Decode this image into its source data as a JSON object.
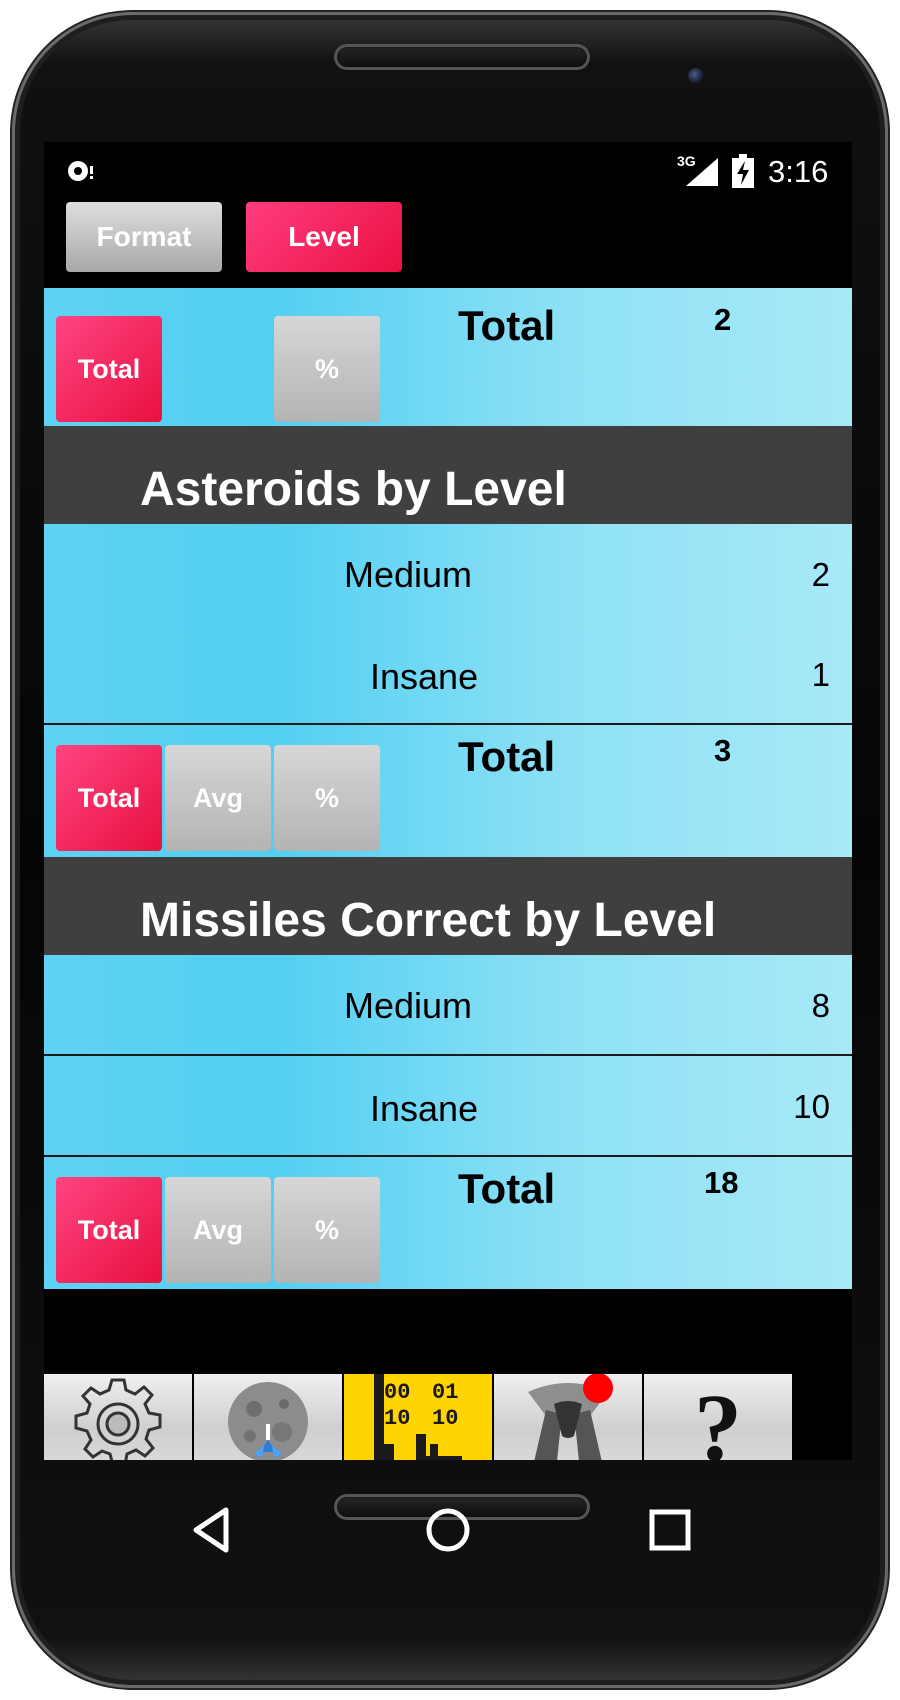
{
  "status_bar": {
    "notification_icon": "wifi-debug-icon",
    "network_type": "3G",
    "time": "3:16"
  },
  "top_tabs": [
    {
      "label": "Format",
      "active": false
    },
    {
      "label": "Level",
      "active": true
    }
  ],
  "summary": {
    "buttons": {
      "total": "Total",
      "percent": "%"
    },
    "total_label": "Total",
    "total_value": "2"
  },
  "sections": [
    {
      "title": "Asteroids by Level",
      "rows": [
        {
          "label": "Medium",
          "value": "2"
        },
        {
          "label": "Insane",
          "value": "1"
        }
      ],
      "buttons": {
        "total": "Total",
        "avg": "Avg",
        "percent": "%"
      },
      "total_label": "Total",
      "total_value": "3"
    },
    {
      "title": "Missiles Correct by Level",
      "rows": [
        {
          "label": "Medium",
          "value": "8"
        },
        {
          "label": "Insane",
          "value": "10"
        }
      ],
      "buttons": {
        "total": "Total",
        "avg": "Avg",
        "percent": "%"
      },
      "total_label": "Total",
      "total_value": "18"
    }
  ],
  "bottom_icons": [
    {
      "name": "settings-gear-icon"
    },
    {
      "name": "asteroid-game-icon"
    },
    {
      "name": "stats-binary-chart-icon",
      "labels": [
        "00",
        "01",
        "10",
        "10"
      ],
      "active": true
    },
    {
      "name": "achievement-ribbon-icon",
      "has_badge": true
    },
    {
      "name": "help-question-icon",
      "glyph": "?"
    }
  ],
  "nav_bar": {
    "back": "back-icon",
    "home": "home-icon",
    "recents": "recents-icon"
  },
  "colors": {
    "accent_red": "#ea1042",
    "cyan": "#52cff2",
    "header_gray": "#3f3f3f",
    "active_icon_bg": "#ffd400"
  }
}
